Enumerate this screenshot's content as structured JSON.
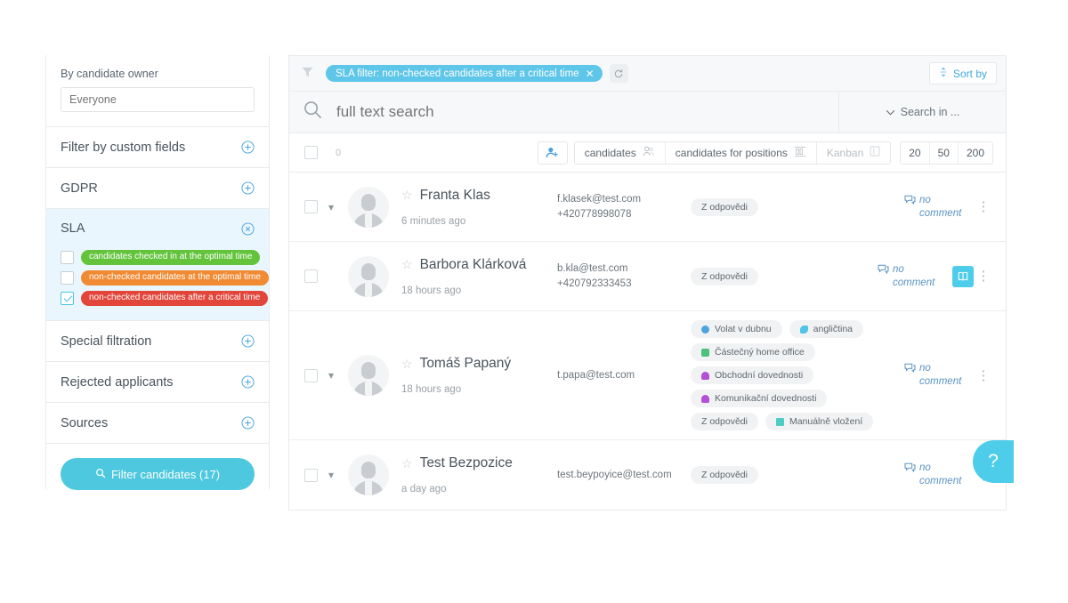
{
  "sidebar": {
    "owner": {
      "label": "By candidate owner",
      "placeholder": "Everyone",
      "value": ""
    },
    "sections": [
      {
        "title": "Filter by custom fields",
        "icon": "plus-circle-icon",
        "state": "collapsed"
      },
      {
        "title": "GDPR",
        "icon": "plus-circle-icon",
        "state": "collapsed"
      },
      {
        "title": "SLA",
        "icon": "close-circle-icon",
        "state": "expanded"
      },
      {
        "title": "Special filtration",
        "icon": "plus-circle-icon",
        "state": "collapsed"
      },
      {
        "title": "Rejected applicants",
        "icon": "plus-circle-icon",
        "state": "collapsed"
      },
      {
        "title": "Sources",
        "icon": "plus-circle-icon",
        "state": "collapsed"
      }
    ],
    "sla_options": [
      {
        "label": "candidates checked in at the optimal time",
        "color": "#63c43c",
        "checked": false
      },
      {
        "label": "non-checked candidates at the optimal time",
        "color": "#f08a33",
        "checked": false
      },
      {
        "label": "non-checked candidates after a critical time",
        "color": "#e2453a",
        "checked": true
      }
    ],
    "filter_button": {
      "label": "Filter candidates (17)",
      "icon": "search-icon",
      "color": "#4ec8de"
    }
  },
  "filterbar": {
    "filter_icon": "funnel-icon",
    "chip": {
      "label": "SLA filter: non-checked candidates after a critical time",
      "remove_icon": "close-icon",
      "color": "#5ec6e8"
    },
    "refresh_icon": "refresh-icon",
    "sort_by": {
      "label": "Sort by",
      "icon": "sort-icon"
    }
  },
  "search": {
    "icon": "search-icon",
    "placeholder": "full text search",
    "value": "",
    "search_in": {
      "label": "Search in ...",
      "icon": "chevron-down-icon"
    }
  },
  "toolbar": {
    "select_all_checked": false,
    "count": "0",
    "add_user_icon": "add-user-icon",
    "views": [
      {
        "label": "candidates",
        "icon": "people-icon",
        "active": true
      },
      {
        "label": "candidates for positions",
        "icon": "board-icon",
        "active": true
      },
      {
        "label": "Kanban",
        "icon": "kanban-icon",
        "active": false
      }
    ],
    "page_sizes": [
      "20",
      "50",
      "200"
    ]
  },
  "candidates": [
    {
      "name": "Franta Klas",
      "time": "6 minutes ago",
      "email": "f.klasek@test.com",
      "phone": "+420778998078",
      "starred": false,
      "selected": false,
      "has_chevron": true,
      "tags": [
        {
          "label": "Z odpovědi",
          "icon": ""
        }
      ],
      "comment": "no comment",
      "book_button": false
    },
    {
      "name": "Barbora Klárková",
      "time": "18 hours ago",
      "email": "b.kla@test.com",
      "phone": "+420792333453",
      "starred": false,
      "selected": false,
      "has_chevron": false,
      "tags": [
        {
          "label": "Z odpovědi",
          "icon": ""
        }
      ],
      "comment": "no comment",
      "book_button": true
    },
    {
      "name": "Tomáš Papaný",
      "time": "18 hours ago",
      "email": "t.papa@test.com",
      "phone": "",
      "starred": false,
      "selected": false,
      "has_chevron": true,
      "tags": [
        {
          "label": "Volat v dubnu",
          "icon": "clock-icon",
          "color": "#4fa3dd"
        },
        {
          "label": "angličtina",
          "icon": "tag-icon",
          "color": "#4fc3e8"
        },
        {
          "label": "Částečný home office",
          "icon": "building-icon",
          "color": "#4cc27a"
        },
        {
          "label": "Obchodní dovednosti",
          "icon": "anchor-icon",
          "color": "#b44fd8"
        },
        {
          "label": "Komunikační dovednosti",
          "icon": "anchor-icon",
          "color": "#b44fd8"
        },
        {
          "label": "Z odpovědi",
          "icon": ""
        },
        {
          "label": "Manuálně vložení",
          "icon": "briefcase-icon",
          "color": "#4ecdc4"
        }
      ],
      "comment": "no comment",
      "book_button": false
    },
    {
      "name": "Test Bezpozice",
      "time": "a day ago",
      "email": "test.beypoyice@test.com",
      "phone": "",
      "starred": false,
      "selected": false,
      "has_chevron": true,
      "tags": [
        {
          "label": "Z odpovědi",
          "icon": ""
        }
      ],
      "comment": "no comment",
      "book_button": false
    }
  ],
  "help": {
    "label": "?",
    "color": "#4ecdea"
  }
}
